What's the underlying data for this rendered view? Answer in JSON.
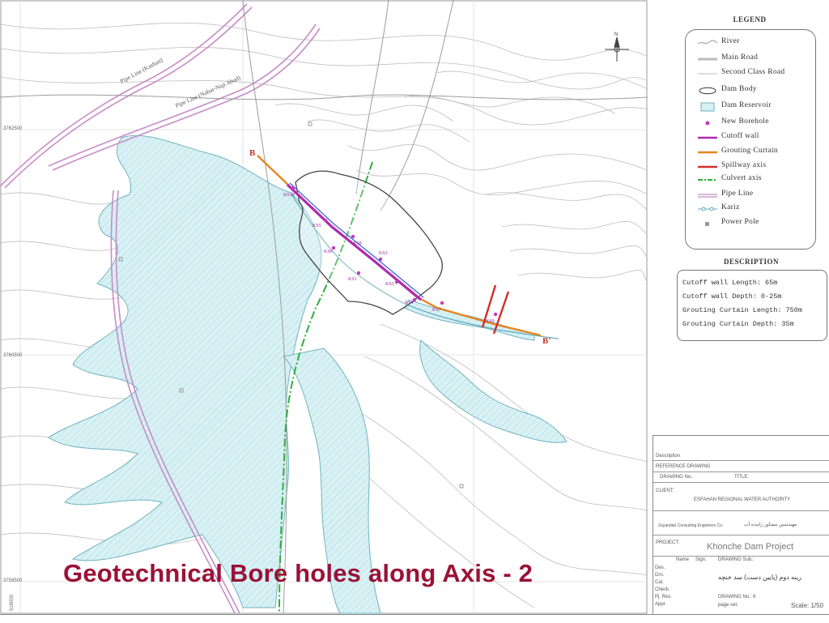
{
  "map": {
    "pipeline_labels": [
      "Pipe Line (Kashan)",
      "Pipe Line (Nabar-Naji Abad)"
    ],
    "section_start": "B",
    "section_end": "B'",
    "northing_labels": [
      "3762500",
      "3760500",
      "3759500"
    ],
    "easting_label": "518000",
    "borehole_labels": [
      "KS10",
      "KS5",
      "KS6",
      "KS8",
      "KS3",
      "KS1",
      "KS2",
      "KS4",
      "KS7",
      "KS9"
    ],
    "north_symbol": "N"
  },
  "legend": {
    "title": "LEGEND",
    "items": [
      {
        "label": "River",
        "symbol": "river"
      },
      {
        "label": "Main Road",
        "symbol": "main-road"
      },
      {
        "label": "Second Class Road",
        "symbol": "second-road"
      },
      {
        "label": "Dam Body",
        "symbol": "dam-body"
      },
      {
        "label": "Dam Reservoir",
        "symbol": "dam-reservoir"
      },
      {
        "label": "New Borehole",
        "symbol": "borehole"
      },
      {
        "label": "Cutoff wall",
        "symbol": "cutoff-wall"
      },
      {
        "label": "Grouting Curtain",
        "symbol": "grouting-curtain"
      },
      {
        "label": "Spillway axis",
        "symbol": "spillway-axis"
      },
      {
        "label": "Culvert axis",
        "symbol": "culvert-axis"
      },
      {
        "label": "Pipe Line",
        "symbol": "pipe-line"
      },
      {
        "label": "Kariz",
        "symbol": "kariz"
      },
      {
        "label": "Power Pole",
        "symbol": "power-pole"
      }
    ]
  },
  "description": {
    "title": "DESCRIPTION",
    "lines": [
      "Cutoff wall Length: 65m",
      "Cutoff wall Depth: 0-25m",
      "Grouting Curtain Length: 750m",
      "Grouting Curtain Depth: 35m"
    ]
  },
  "title_block": {
    "description_label": "Description",
    "reference_drawing": "REFERENCE DRAWING",
    "drawing_no_label": "DRAWING No.:",
    "title_label": "TITLE:",
    "client_label": "CLIENT:",
    "client": "ESFAHAN REGIONAL WATER AUTHORITY",
    "consultant": "Zayandab Consulting Engineers Co.",
    "consultant_fa": "مهندسین مشاور زاینده آب",
    "project_label": "PROJECT:",
    "project": "Khonche Dam Project",
    "drawing_sub_label": "DRAWING Sub.:",
    "drawing_sub_fa": "رینه دوم (پایین دست) سد خنچه",
    "role_labels": [
      "Des.",
      "Drn.",
      "Cal.",
      "Check.",
      "Pj. Res.",
      "Appr."
    ],
    "name_label": "Name",
    "sign_label": "Sign.",
    "drawing_no_footer": "DRAWING No.: 6",
    "page_label": "page set:",
    "scale": "Scale: 1/50"
  },
  "colors": {
    "reservoir": "#d6f0f3",
    "river": "#5fa8b5",
    "contour": "#b9b9b9",
    "pipeline": "#c88cc8",
    "grouting": "#e8851e",
    "cutoff": "#b02ab0",
    "spillway": "#d0302c",
    "culvert": "#2fae3c",
    "borehole": "#c03cc0",
    "title": "#9a1238"
  },
  "slide_title": "Geotechnical Bore holes along Axis - 2"
}
